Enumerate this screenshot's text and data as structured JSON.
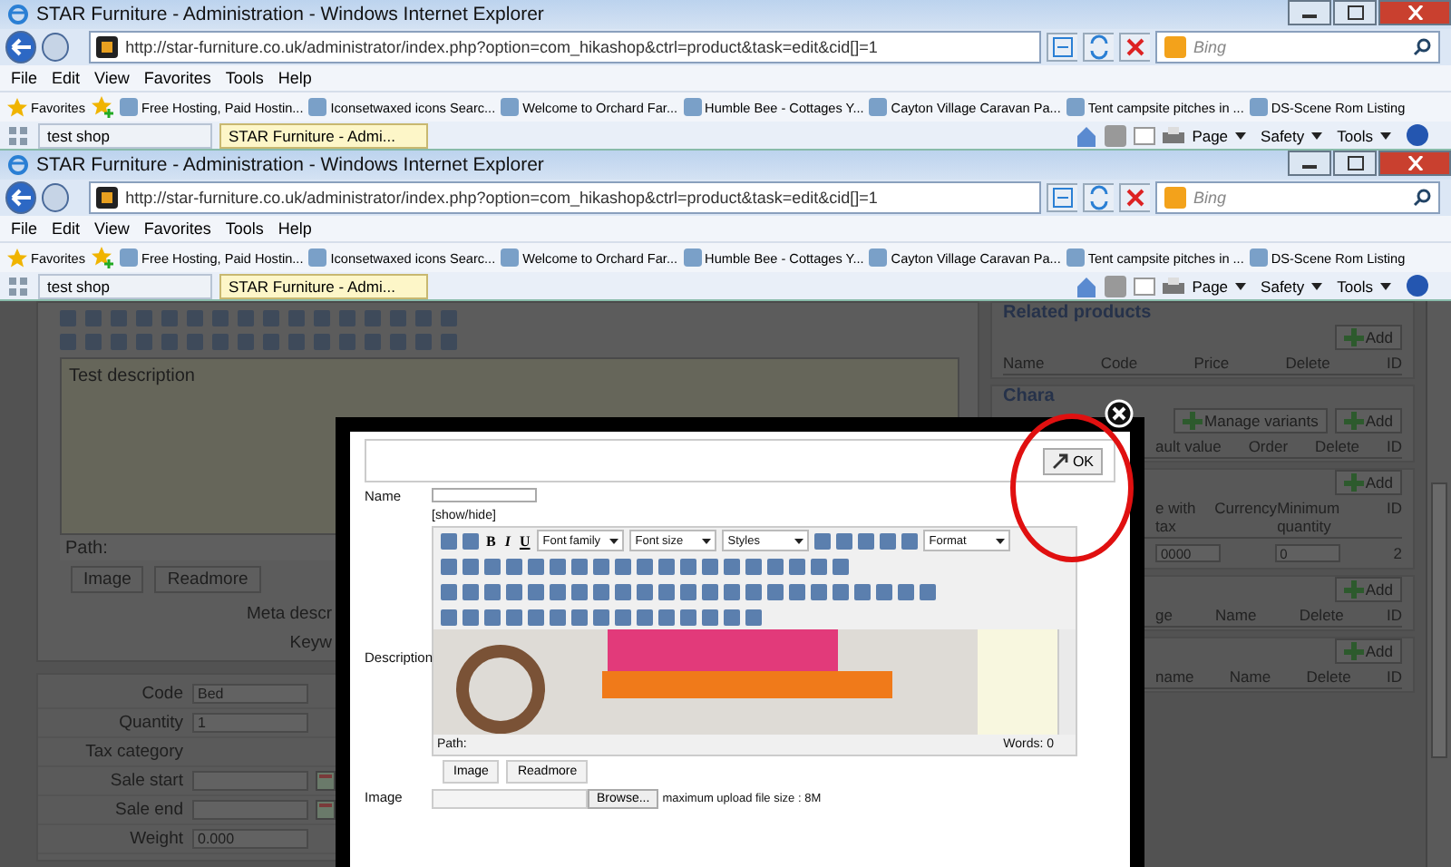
{
  "windows": [
    {
      "title": "STAR Furniture - Administration - Windows Internet Explorer",
      "address": "http://star-furniture.co.uk/administrator/index.php?option=com_hikashop&ctrl=product&task=edit&cid[]=1",
      "search_placeholder": "Bing",
      "menu": [
        "File",
        "Edit",
        "View",
        "Favorites",
        "Tools",
        "Help"
      ],
      "favorites_label": "Favorites",
      "favorites": [
        "Free Hosting, Paid Hostin...",
        "Iconsetwaxed icons  Searc...",
        "Welcome to Orchard Far...",
        "Humble Bee - Cottages Y...",
        "Cayton Village Caravan Pa...",
        "Tent campsite pitches in ...",
        "DS-Scene Rom Listing"
      ],
      "tabs": [
        {
          "label": "test shop",
          "selected": false
        },
        {
          "label": "STAR Furniture - Admi...",
          "selected": true
        }
      ],
      "commands": [
        "Page",
        "Safety",
        "Tools"
      ]
    },
    {
      "title": "STAR Furniture - Administration - Windows Internet Explorer",
      "address": "http://star-furniture.co.uk/administrator/index.php?option=com_hikashop&ctrl=product&task=edit&cid[]=1",
      "search_placeholder": "Bing",
      "menu": [
        "File",
        "Edit",
        "View",
        "Favorites",
        "Tools",
        "Help"
      ],
      "favorites_label": "Favorites",
      "favorites": [
        "Free Hosting, Paid Hostin...",
        "Iconsetwaxed icons  Searc...",
        "Welcome to Orchard Far...",
        "Humble Bee - Cottages Y...",
        "Cayton Village Caravan Pa...",
        "Tent campsite pitches in ...",
        "DS-Scene Rom Listing"
      ],
      "tabs": [
        {
          "label": "test shop",
          "selected": false
        },
        {
          "label": "STAR Furniture - Admi...",
          "selected": true
        }
      ],
      "commands": [
        "Page",
        "Safety",
        "Tools"
      ]
    }
  ],
  "page": {
    "editor": {
      "text": "Test description",
      "path": "Path:",
      "buttons": [
        "Image",
        "Readmore"
      ]
    },
    "meta_labels": [
      "Meta descr",
      "Keyw"
    ],
    "fields": [
      {
        "kind": "text",
        "label": "Code",
        "value": "Bed"
      },
      {
        "kind": "text",
        "label": "Quantity",
        "value": "1"
      },
      {
        "kind": "label",
        "label": "Tax category"
      },
      {
        "kind": "date",
        "label": "Sale start"
      },
      {
        "kind": "date",
        "label": "Sale end"
      },
      {
        "kind": "text",
        "label": "Weight",
        "value": "0.000"
      }
    ],
    "panels": [
      {
        "title": "Related products",
        "buttons": [
          "Add"
        ],
        "columns": [
          "Name",
          "Code",
          "Price",
          "Delete",
          "ID"
        ]
      },
      {
        "title": "Chara",
        "buttons": [
          "Manage variants",
          "Add"
        ],
        "columns": [
          "ault value",
          "Order",
          "Delete",
          "ID"
        ]
      },
      {
        "buttons": [
          "Add"
        ],
        "columns": [
          "e with tax",
          "Currency",
          "Minimum quantity",
          "ID"
        ],
        "row": {
          "price": "0000",
          "minimum_quantity": "0",
          "id": "2"
        }
      },
      {
        "buttons": [
          "Add"
        ],
        "columns": [
          "ge",
          "Name",
          "Delete",
          "ID"
        ]
      },
      {
        "buttons": [
          "Add"
        ],
        "columns": [
          "name",
          "Name",
          "Delete",
          "ID"
        ]
      }
    ]
  },
  "dialog": {
    "ok": "OK",
    "name_label": "Name",
    "toggle": "[show/hide]",
    "toolbar_letters": [
      "B",
      "I",
      "U"
    ],
    "toolbar_selects": [
      "Font family",
      "Font size",
      "Styles",
      "Format"
    ],
    "description_label": "Description",
    "path": "Path:",
    "words": "Words: 0",
    "buttons": [
      "Image",
      "Readmore"
    ],
    "image_label": "Image",
    "browse": "Browse...",
    "upload_hint": "maximum upload file size : 8M"
  }
}
